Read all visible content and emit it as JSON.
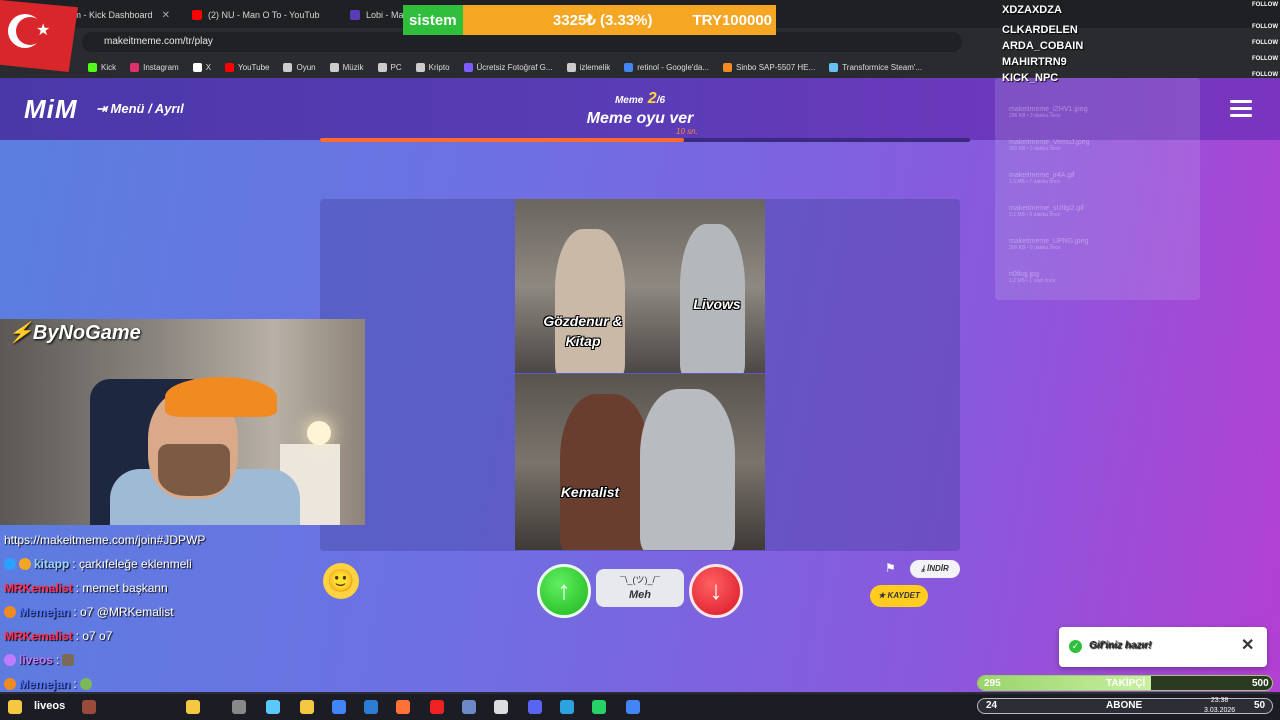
{
  "browser": {
    "tabs": [
      {
        "label": "Stream - Kick Dashboard",
        "color": "#53fc18"
      },
      {
        "label": "(2) NU - Man O To - YouTub",
        "color": "#ff0000"
      },
      {
        "label": "Lobi - Mak",
        "color": "#5a3cb6"
      }
    ],
    "url": "makeitmeme.com/tr/play",
    "bookmarks": [
      {
        "label": "Kick",
        "color": "#53fc18"
      },
      {
        "label": "Instagram",
        "color": "#e1306c"
      },
      {
        "label": "X",
        "color": "#ffffff"
      },
      {
        "label": "YouTube",
        "color": "#ff0000"
      },
      {
        "label": "Oyun",
        "color": "#cccccc"
      },
      {
        "label": "Müzik",
        "color": "#cccccc"
      },
      {
        "label": "PC",
        "color": "#cccccc"
      },
      {
        "label": "Kripto",
        "color": "#cccccc"
      },
      {
        "label": "Ücretsiz Fotoğraf G...",
        "color": "#7b5cff"
      },
      {
        "label": "izlemelik",
        "color": "#cccccc"
      },
      {
        "label": "retinol - Google'da...",
        "color": "#4285f4"
      },
      {
        "label": "Sinbo SAP-5507 HE...",
        "color": "#f28a22"
      },
      {
        "label": "Transformice Steam'...",
        "color": "#66c0f4"
      }
    ]
  },
  "ticker": {
    "label": "sistem",
    "amount": "3325₺ (3.33%)",
    "goal": "TRY100000"
  },
  "app": {
    "logo": "MiM",
    "menu_link": "Menü / Ayrıl",
    "round_prefix": "Meme",
    "round_current": "2",
    "round_total": "/6",
    "round_title": "Meme oyu ver",
    "timer": "10 sn.",
    "progress_fraction": 0.56,
    "meme": {
      "top_left_caption": "Gözdenur & Kitap",
      "top_right_caption": "Livows",
      "bottom_caption": "Kemalist"
    },
    "vote": {
      "meh_face": "¯\\_(ツ)_/¯",
      "meh_label": "Meh"
    },
    "indir_label": "İNDİR",
    "kaydet_label": "KAYDET",
    "toast": "Gif'iniz hazır!"
  },
  "downloads": [
    {
      "name": "makeitmeme_iZHV1.jpeg",
      "info": "296 KB • 3 dakika önce"
    },
    {
      "name": "makeitmeme_VemuJ.jpeg",
      "info": "332 KB • 3 dakika önce"
    },
    {
      "name": "makeitmeme_jr4A.gif",
      "info": "1.5 MB • 7 dakika önce"
    },
    {
      "name": "makeitmeme_sUtlgi2.gif",
      "info": "2.1 MB • 9 dakika önce"
    },
    {
      "name": "makeitmeme_UPNG.jpeg",
      "info": "300 KB • 9 dakika önce"
    },
    {
      "name": "n0tkqj.jpg",
      "info": "1.2 MB • 1 saat önce"
    }
  ],
  "stream": {
    "brand": "ByNoGame",
    "chat": [
      {
        "user": "",
        "text": "https://makeitmeme.com/join#JDPWP",
        "color": "#ffffff"
      },
      {
        "user": "kitapp",
        "text": ": çarkıfeleğe eklenmeli",
        "color": "#9fd6ff"
      },
      {
        "user": "MRKemalist",
        "text": ": memet başkann",
        "color": "#ff3355"
      },
      {
        "user": "Memejan",
        "text": ": o7 @MRKemalist",
        "color": "#5577ff"
      },
      {
        "user": "MRKemalist",
        "text": ": o7 o7",
        "color": "#ff3355"
      },
      {
        "user": "liveos",
        "text": ":",
        "color": "#c07bff"
      },
      {
        "user": "Memejan",
        "text": ":",
        "color": "#5577ff"
      }
    ],
    "followers": [
      "XDZAXDZA",
      "CLKARDELEN",
      "ARDA_COBAIN",
      "MAHIRTRN9",
      "KICK_NPC"
    ],
    "follow_tag": "FOLLOW",
    "takipci": {
      "current": "295",
      "label": "TAKİPÇİ",
      "goal": "500",
      "fraction": 0.59
    },
    "abone": {
      "current": "24",
      "label": "ABONE",
      "goal": "50",
      "fraction": 0.48
    },
    "taskbar_user": "liveos",
    "clock_time": "23:38",
    "clock_date": "3.03.2026"
  }
}
